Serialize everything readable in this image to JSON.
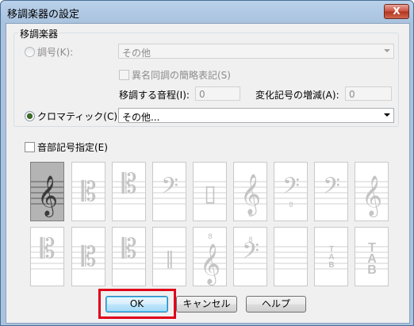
{
  "window": {
    "title": "移調楽器の設定",
    "close_label": "X"
  },
  "group": {
    "legend": "移調楽器",
    "key": {
      "label": "調号(K):",
      "value": "その他",
      "checked": false
    },
    "enharmonic": {
      "label": "異名同調の簡略表記(S)"
    },
    "interval": {
      "label": "移調する音程(I):",
      "value": "0"
    },
    "accidental": {
      "label": "変化記号の増減(A):",
      "value": "0"
    },
    "chromatic": {
      "label": "クロマティック(C):",
      "value": "その他...",
      "checked": true
    }
  },
  "clef_checkbox": {
    "label": "音部記号指定(E)"
  },
  "clefs": [
    [
      "treble",
      "alto",
      "tenor",
      "bass",
      "percussion",
      "treble-8vb",
      "bass-8vb",
      "bass",
      "treble"
    ],
    [
      "tenor",
      "alto",
      "tenor",
      "percussion2",
      "treble-8va",
      "bass-8va",
      "blank",
      "tab-small",
      "tab-large"
    ]
  ],
  "buttons": {
    "ok": "OK",
    "cancel": "キャンセル",
    "help": "ヘルプ"
  }
}
